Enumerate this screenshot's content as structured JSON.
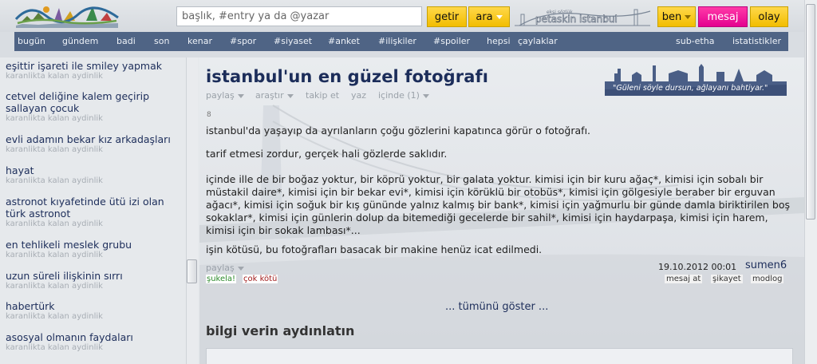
{
  "header": {
    "logo_text": "ekşisözlük",
    "search": {
      "placeholder": "başlık, #entry ya da @yazar",
      "value": ""
    },
    "getir_label": "getir",
    "ara_label": "ara",
    "promo_small": "ekşi sözlük",
    "promo_main": "petaskin istanbul",
    "ben_label": "ben",
    "mesaj_label": "mesaj",
    "olay_label": "olay"
  },
  "nav": {
    "items": [
      "bugün",
      "gündem",
      "badi",
      "son",
      "kenar",
      "#spor",
      "#siyaset",
      "#anket",
      "#ilişkiler",
      "#spoiler",
      "hepsi",
      "çaylaklar"
    ],
    "right_items": [
      "sub-etha",
      "istatistikler"
    ]
  },
  "sidebar": {
    "subtitle": "karanlikta kalan aydinlik",
    "topics": [
      {
        "title": "eşittir işareti ile smiley yapmak"
      },
      {
        "title": "cetvel deliğine kalem geçirip sallayan çocuk"
      },
      {
        "title": "evli adamın bekar kız arkadaşları"
      },
      {
        "title": "hayat"
      },
      {
        "title": "astronot kıyafetinde ütü izi olan türk astronot"
      },
      {
        "title": "en tehlikeli meslek grubu"
      },
      {
        "title": "uzun süreli ilişkinin sırrı"
      },
      {
        "title": "habertürk"
      },
      {
        "title": "asosyal olmanın faydaları"
      }
    ]
  },
  "main": {
    "title": "istanbul'un en güzel fotoğrafı",
    "skyline_quote": "\"Güleni söyle dursun, ağlayanı bahtiyar.\"",
    "tools": [
      "paylaş",
      "araştır",
      "takip et",
      "yaz",
      "içinde (1)"
    ],
    "entry": {
      "number": "8",
      "paragraphs": [
        "istanbul'da yaşayıp da ayrılanların çoğu gözlerini kapatınca görür o fotoğrafı.",
        "tarif etmesi zordur, gerçek hali gözlerde saklıdır.",
        "içinde ille de bir boğaz yoktur, bir köprü yoktur, bir galata yoktur. kimisi için bir kuru ağaç*, kimisi için sobalı bir müstakil daire*, kimisi için bir bekar evi*, kimisi için körüklü bir otobüs*, kimisi için gölgesiyle beraber bir erguvan ağacı*, kimisi için soğuk bir kış gününde yalnız kalmış bir bank*, kimisi için yağmurlu bir günde damla biriktirilen boş sokaklar*, kimisi için günlerin dolup da bitemediği gecelerde bir sahil*, kimisi için haydarpaşa, kimisi için harem, kimisi için bir sokak lambası*...",
        "işin kötüsü, bu fotoğrafları basacak bir makine henüz icat edilmedi."
      ],
      "share_label": "paylaş",
      "date": "19.10.2012 00:01",
      "author": "sumen6",
      "vote_good": "şukela!",
      "vote_bad": "çok kötü",
      "actions": [
        "mesaj at",
        "şikayet",
        "modlog"
      ]
    },
    "show_all": "... tümünü göster ...",
    "section_heading": "bilgi verin aydınlatın"
  },
  "colors": {
    "nav_bg": "#4f6485",
    "accent_yellow": "#f2bd00",
    "accent_pink": "#e4008f",
    "link_blue": "#1c2d5a"
  }
}
